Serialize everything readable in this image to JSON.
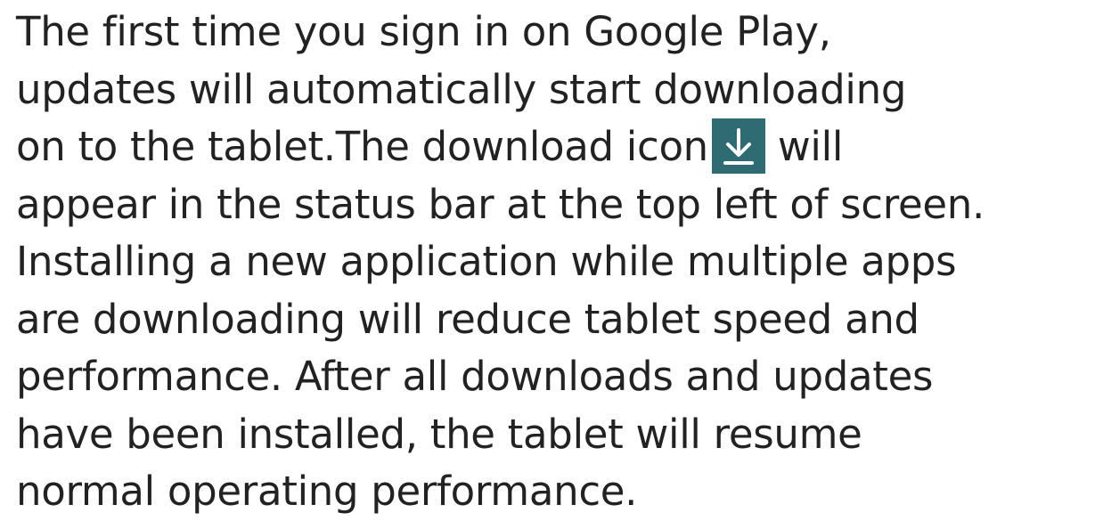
{
  "paragraph": {
    "line_1": "The first time you sign in on Google Play,",
    "line_2": "updates will automatically start downloading",
    "line_3_before_icon": "on to the tablet.The download icon",
    "line_3_after_icon": "will",
    "line_4": "appear in the status bar at the top left of screen.",
    "line_5": "Installing a new application while multiple apps",
    "line_6": "are downloading will reduce tablet speed and",
    "line_7": "performance. After all downloads and updates",
    "line_8": "have been installed, the tablet will resume",
    "line_9": "normal operating performance."
  },
  "icons": {
    "inline": "download-icon",
    "icon_background": "#2e6b73",
    "icon_foreground": "#ffffff"
  },
  "colors": {
    "text": "#222222",
    "background": "#ffffff"
  }
}
